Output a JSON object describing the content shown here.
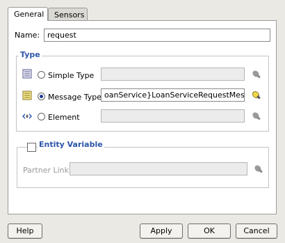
{
  "tabs": {
    "general": "General",
    "sensors": "Sensors"
  },
  "name": {
    "label": "Name:",
    "value": "request"
  },
  "type_group": {
    "title": "Type",
    "simple_type": {
      "label": "Simple Type",
      "value": ""
    },
    "message_type": {
      "label": "Message Type",
      "value": "oanService}LoanServiceRequestMessage",
      "selected": true
    },
    "element": {
      "label": "Element",
      "value": ""
    }
  },
  "entity_group": {
    "title": "Entity Variable",
    "partner_link": {
      "label": "Partner Link:",
      "value": ""
    }
  },
  "buttons": {
    "help": "Help",
    "apply": "Apply",
    "ok": "OK",
    "cancel": "Cancel"
  },
  "colors": {
    "group_title": "#2b55a8",
    "panel_bg": "#ffffff",
    "window_bg": "#ebe9e4"
  }
}
